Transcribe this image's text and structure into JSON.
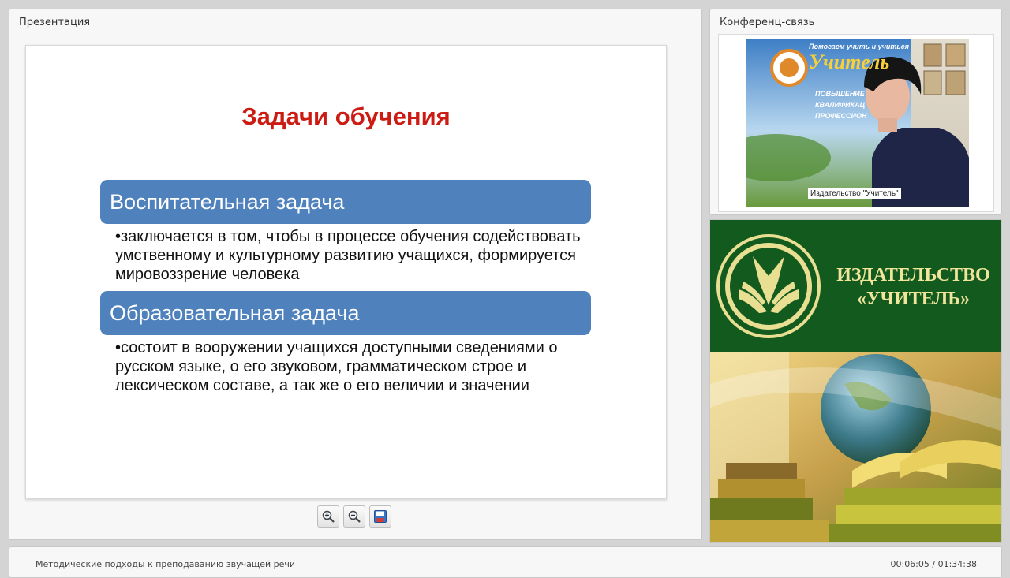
{
  "presentation": {
    "panel_title": "Презентация",
    "slide": {
      "title": "Задачи обучения",
      "tasks": [
        {
          "heading": "Воспитательная задача",
          "text": "•заключается в том, чтобы в процессе обучения содействовать умственному и культурному развитию учащихся,  формируется мировоззрение человека"
        },
        {
          "heading": "Образовательная задача",
          "text": "•состоит в вооружении учащихся доступными сведениями о русском языке, о его звуковом, грамматическом строе и лексическом составе, а так же о его величии и значении"
        }
      ]
    },
    "toolbar": {
      "zoom_in": "zoom-in-icon",
      "zoom_out": "zoom-out-icon",
      "save": "floppy-disk-icon"
    }
  },
  "conference": {
    "panel_title": "Конференц-связь",
    "video_caption": "Издательство \"Учитель\"",
    "banner": {
      "line1": "Помогаем учить и учиться",
      "brand": "Учитель",
      "bullet1": "ПОВЫШЕНИЕ",
      "bullet2": "КВАЛИФИКАЦ",
      "bullet3": "ПРОФЕССИОН"
    }
  },
  "publisher": {
    "line1": "ИЗДАТЕЛЬСТВО",
    "line2": "«УЧИТЕЛЬ»"
  },
  "footer": {
    "title": "Методические подходы к преподаванию звучащей речи",
    "time": "00:06:05 / 01:34:38"
  },
  "colors": {
    "slide_title": "#cc1b12",
    "task_heading_bg": "#4f81bd",
    "publisher_green": "#135a1f",
    "publisher_gold": "#f0e59a"
  }
}
